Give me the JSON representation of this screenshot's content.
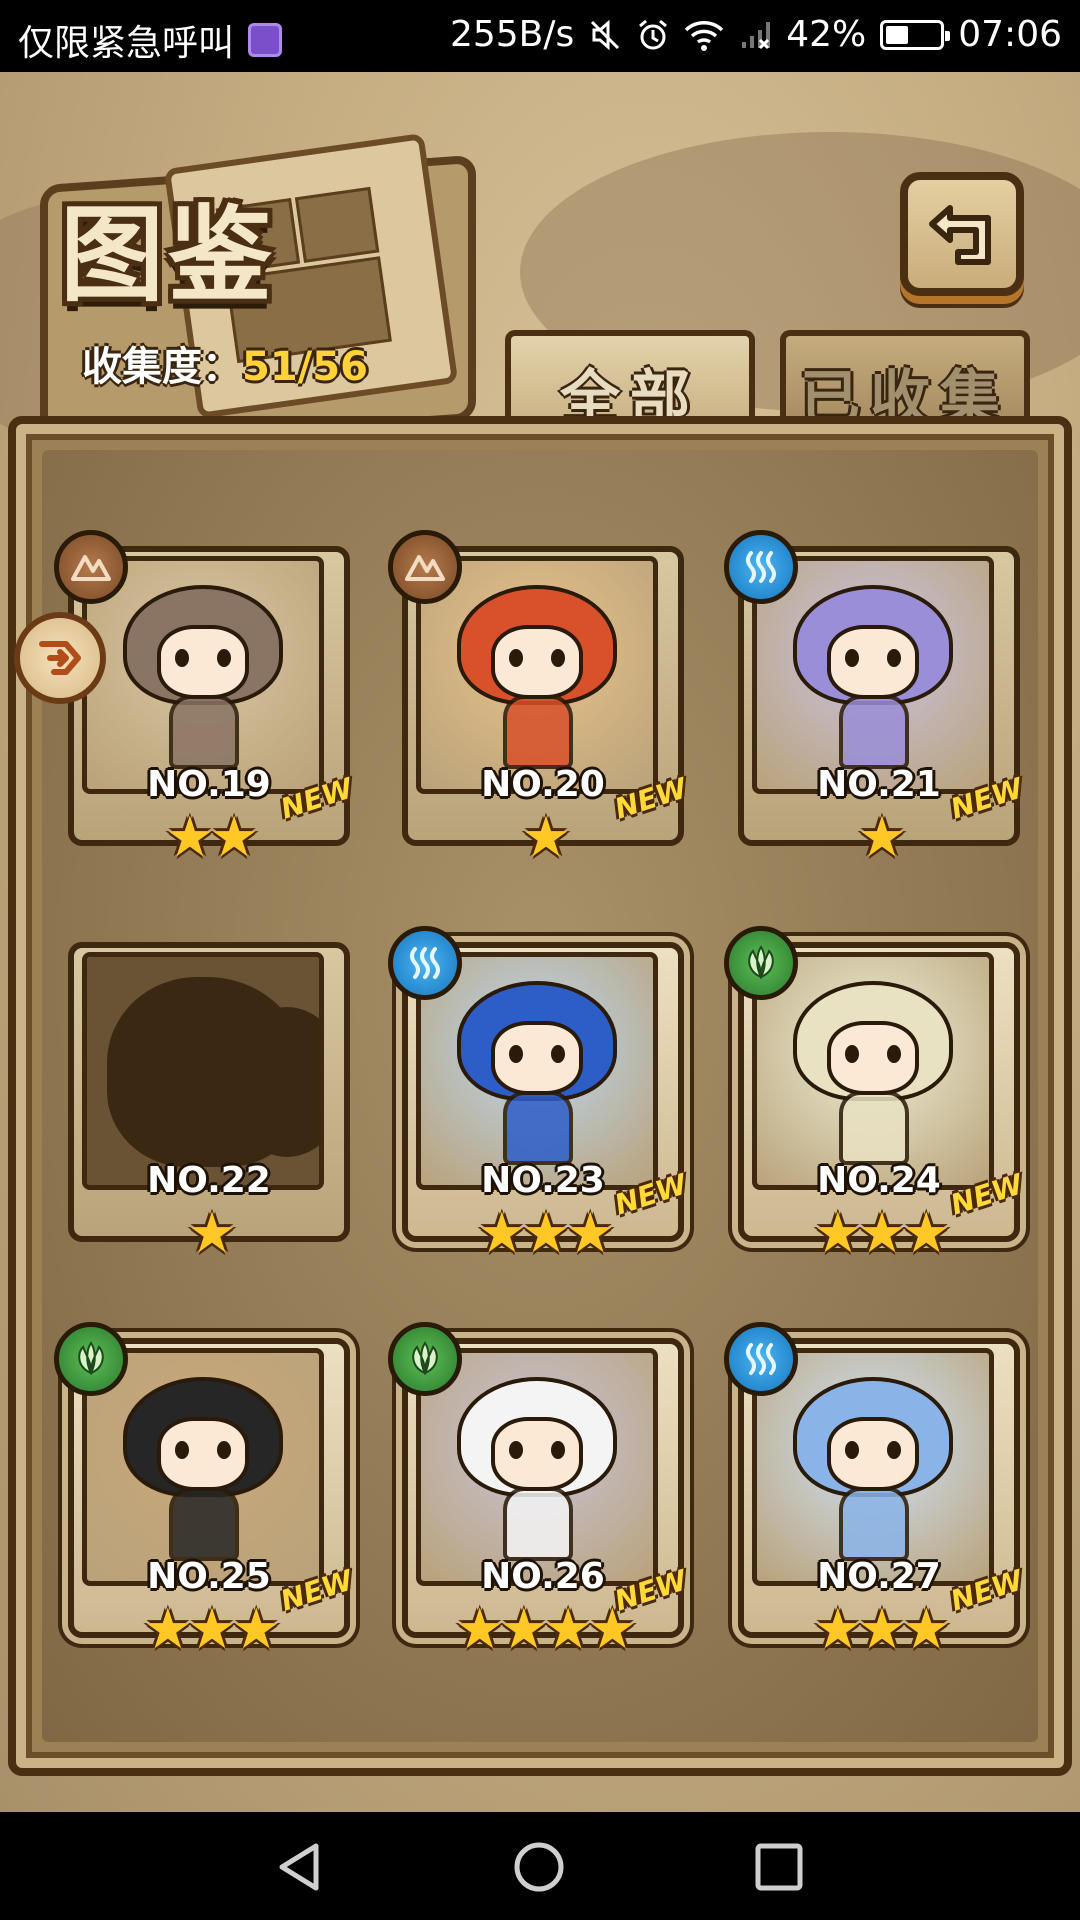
{
  "status_bar": {
    "carrier": "仅限紧急呼叫",
    "speed": "255B/s",
    "battery": "42%",
    "battery_level": 0.42,
    "time": "07:06",
    "icons": [
      "gallery-icon",
      "mute-icon",
      "alarm-icon",
      "wifi-icon",
      "signal-icon",
      "battery-icon"
    ]
  },
  "header": {
    "title": "图鉴",
    "collection_label": "收集度：",
    "collection_value": "51/56"
  },
  "tabs": [
    {
      "label": "全部",
      "selected": true
    },
    {
      "label": "已收集",
      "selected": false
    }
  ],
  "cards": [
    {
      "number": "NO.19",
      "stars": "★★",
      "star_count": 2,
      "new": "NEW",
      "element": "earth",
      "collected": true,
      "art": "#d9c6a0",
      "hair": "#8a7463"
    },
    {
      "number": "NO.20",
      "stars": "★",
      "star_count": 1,
      "new": "NEW",
      "element": "earth",
      "collected": true,
      "art": "#e8c28a",
      "hair": "#d8512a"
    },
    {
      "number": "NO.21",
      "stars": "★",
      "star_count": 1,
      "new": "NEW",
      "element": "water",
      "collected": true,
      "art": "#c9c3e0",
      "hair": "#9a8ed8"
    },
    {
      "number": "NO.22",
      "stars": "★",
      "star_count": 1,
      "new": "",
      "element": "",
      "collected": false,
      "art": "#6a5334",
      "hair": "#3b2812"
    },
    {
      "number": "NO.23",
      "stars": "★★★",
      "star_count": 3,
      "new": "NEW",
      "element": "water",
      "collected": true,
      "art": "#bcd6ee",
      "hair": "#2d5ec8"
    },
    {
      "number": "NO.24",
      "stars": "★★★",
      "star_count": 3,
      "new": "NEW",
      "element": "wood",
      "collected": true,
      "art": "#eef0d6",
      "hair": "#e9e2c2"
    },
    {
      "number": "NO.25",
      "stars": "★★★",
      "star_count": 3,
      "new": "NEW",
      "element": "wood",
      "collected": true,
      "art": "#c9a87a",
      "hair": "#262626"
    },
    {
      "number": "NO.26",
      "stars": "★★★★",
      "star_count": 4,
      "new": "NEW",
      "element": "wood",
      "collected": true,
      "art": "#c8c4d8",
      "hair": "#f4f4f4"
    },
    {
      "number": "NO.27",
      "stars": "★★★",
      "star_count": 3,
      "new": "NEW",
      "element": "water",
      "collected": true,
      "art": "#cfe2f6",
      "hair": "#8ab4e8"
    }
  ],
  "colors": {
    "earth": "#8f5a32",
    "water": "#1f86d0",
    "wood": "#3a8f3a",
    "accent_gold": "#ffd23a"
  },
  "nav": {
    "icons": [
      "back-triangle-icon",
      "home-circle-icon",
      "recents-square-icon"
    ]
  }
}
